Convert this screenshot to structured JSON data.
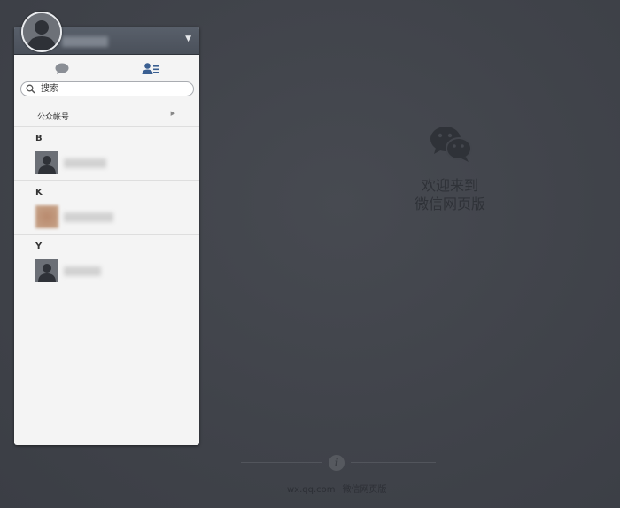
{
  "sidebar": {
    "header": {
      "dropdown_glyph": "▼"
    },
    "tabs": [
      {
        "id": "chat",
        "icon": "chat-bubble-icon"
      },
      {
        "id": "contacts",
        "icon": "contacts-icon",
        "active": true
      }
    ],
    "search": {
      "placeholder": "搜索",
      "value": ""
    },
    "public_accounts": {
      "label": "公众帐号",
      "arrow": "▶"
    },
    "groups": [
      {
        "letter": "B",
        "contacts": [
          {
            "avatar": "person-silhouette"
          }
        ]
      },
      {
        "letter": "K",
        "contacts": [
          {
            "avatar": "photo-brown"
          }
        ]
      },
      {
        "letter": "Y",
        "contacts": [
          {
            "avatar": "person-silhouette"
          }
        ]
      }
    ]
  },
  "welcome": {
    "line1": "欢迎来到",
    "line2": "微信网页版",
    "logo_icon": "wechat-logo-icon"
  },
  "footer": {
    "info_glyph": "i",
    "link1": "wx.qq.com",
    "link2": "微信网页版"
  },
  "colors": {
    "background": "#3f4249",
    "panel": "#f4f4f4",
    "header": "#4f5560",
    "accent": "#3a5f91"
  }
}
